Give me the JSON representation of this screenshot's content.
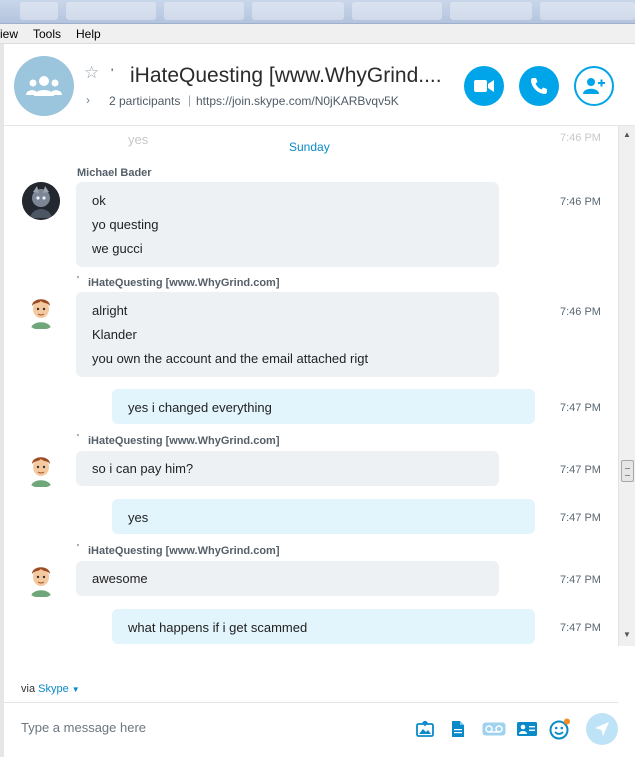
{
  "menu": {
    "view": "iew",
    "tools": "Tools",
    "help": "Help"
  },
  "header": {
    "title_tick": "'",
    "title": "iHateQuesting [www.WhyGrind....",
    "participants": "2 participants",
    "separator": "|",
    "join_link": "https://join.skype.com/N0jKARBvqv5K"
  },
  "colors": {
    "accent": "#00a4e8",
    "bubble_other": "#eef1f4",
    "bubble_self": "#e2f4fc",
    "day_separator": "#0a8ac7"
  },
  "chat": {
    "ghost_message": {
      "text": "yes",
      "time": "7:46 PM"
    },
    "day_separator": "Sunday",
    "groups": [
      {
        "sender_tick": "",
        "sender": "Michael Bader",
        "lines": [
          "ok",
          "yo questing",
          "we gucci"
        ],
        "time": "7:46 PM"
      },
      {
        "sender_tick": "'",
        "sender": "iHateQuesting [www.WhyGrind.com]",
        "lines": [
          "alright",
          "Klander",
          "you own the account and the email attached rigt"
        ],
        "time": "7:46 PM"
      },
      {
        "self": true,
        "lines": [
          "yes i changed everything"
        ],
        "time": "7:47 PM"
      },
      {
        "sender_tick": "'",
        "sender": "iHateQuesting [www.WhyGrind.com]",
        "lines": [
          "so i can pay him?"
        ],
        "time": "7:47 PM"
      },
      {
        "self": true,
        "lines": [
          "yes"
        ],
        "time": "7:47 PM"
      },
      {
        "sender_tick": "'",
        "sender": "iHateQuesting [www.WhyGrind.com]",
        "lines": [
          "awesome"
        ],
        "time": "7:47 PM"
      },
      {
        "self": true,
        "lines": [
          "what happens if i get scammed"
        ],
        "time": "7:47 PM"
      }
    ]
  },
  "footer": {
    "via_prefix": "via",
    "via_link": "Skype",
    "composer_placeholder": "Type a message here"
  },
  "icons": {
    "header": [
      "group-icon",
      "star-icon",
      "chevron-right-icon",
      "video-call-icon",
      "audio-call-icon",
      "add-participant-icon"
    ],
    "composer": [
      "media-icon",
      "file-icon",
      "voice-message-icon",
      "contact-card-icon",
      "emoticon-icon",
      "send-icon"
    ]
  }
}
